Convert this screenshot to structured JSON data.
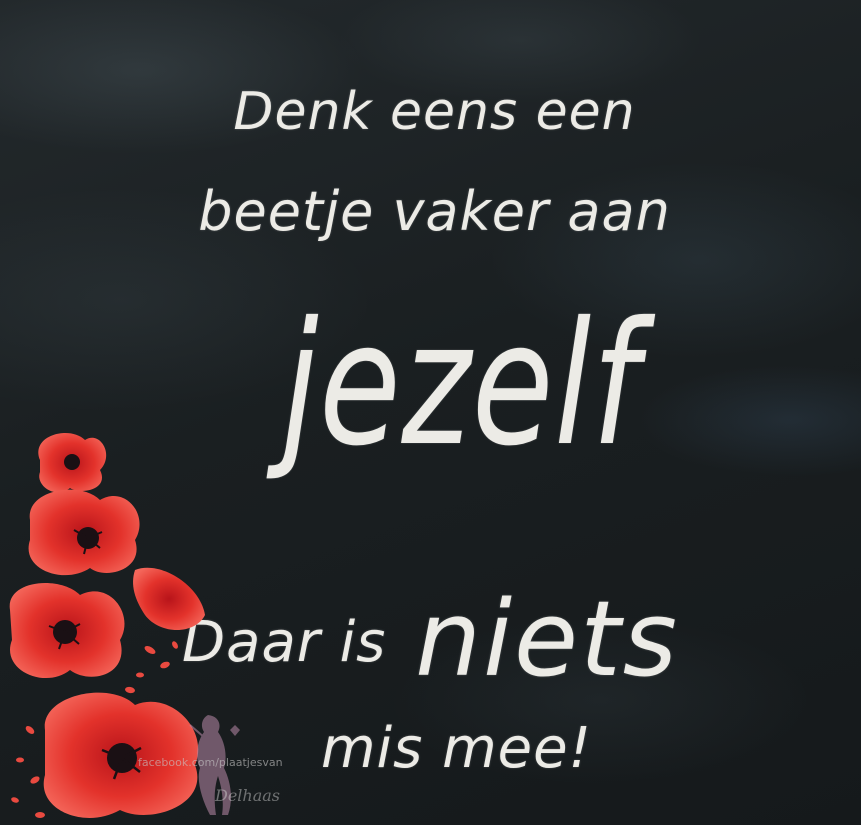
{
  "quote": {
    "line1": "Denk eens een",
    "line2": "beetje vaker aan",
    "line3": "jezelf",
    "line4_small": "Daar is",
    "line4_big": "niets",
    "line5": "mis mee!"
  },
  "watermark": {
    "url_text": "facebook.com/plaatjesvan",
    "signature": "Delhaas"
  },
  "colors": {
    "chalkboard": "#1a1f21",
    "chalk_text": "#ecebe6",
    "poppy_red": "#e3322b",
    "poppy_center": "#1a1014"
  },
  "icons": [
    "poppy-flower-icon",
    "woman-silhouette-watermark-icon"
  ]
}
